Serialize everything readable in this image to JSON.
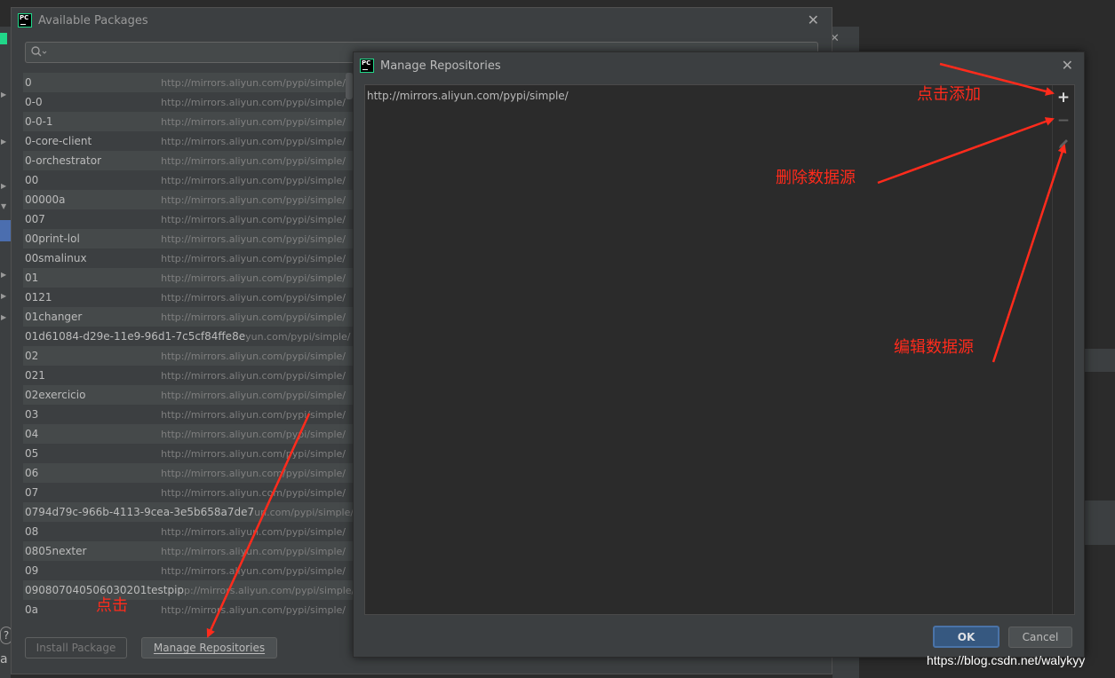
{
  "available_dialog": {
    "title": "Available Packages",
    "install_button": "Install Package",
    "manage_button": "Manage Repositories",
    "packages": [
      {
        "name": "0",
        "repo": "http://mirrors.aliyun.com/pypi/simple/"
      },
      {
        "name": "0-0",
        "repo": "http://mirrors.aliyun.com/pypi/simple/"
      },
      {
        "name": "0-0-1",
        "repo": "http://mirrors.aliyun.com/pypi/simple/"
      },
      {
        "name": "0-core-client",
        "repo": "http://mirrors.aliyun.com/pypi/simple/"
      },
      {
        "name": "0-orchestrator",
        "repo": "http://mirrors.aliyun.com/pypi/simple/"
      },
      {
        "name": "00",
        "repo": "http://mirrors.aliyun.com/pypi/simple/"
      },
      {
        "name": "00000a",
        "repo": "http://mirrors.aliyun.com/pypi/simple/"
      },
      {
        "name": "007",
        "repo": "http://mirrors.aliyun.com/pypi/simple/"
      },
      {
        "name": "00print-lol",
        "repo": "http://mirrors.aliyun.com/pypi/simple/"
      },
      {
        "name": "00smalinux",
        "repo": "http://mirrors.aliyun.com/pypi/simple/"
      },
      {
        "name": "01",
        "repo": "http://mirrors.aliyun.com/pypi/simple/"
      },
      {
        "name": "0121",
        "repo": "http://mirrors.aliyun.com/pypi/simple/"
      },
      {
        "name": "01changer",
        "repo": "http://mirrors.aliyun.com/pypi/simple/"
      },
      {
        "name": "01d61084-d29e-11e9-96d1-7c5cf84ffe8e",
        "repo": "yun.com/pypi/simple/"
      },
      {
        "name": "02",
        "repo": "http://mirrors.aliyun.com/pypi/simple/"
      },
      {
        "name": "021",
        "repo": "http://mirrors.aliyun.com/pypi/simple/"
      },
      {
        "name": "02exercicio",
        "repo": "http://mirrors.aliyun.com/pypi/simple/"
      },
      {
        "name": "03",
        "repo": "http://mirrors.aliyun.com/pypi/simple/"
      },
      {
        "name": "04",
        "repo": "http://mirrors.aliyun.com/pypi/simple/"
      },
      {
        "name": "05",
        "repo": "http://mirrors.aliyun.com/pypi/simple/"
      },
      {
        "name": "06",
        "repo": "http://mirrors.aliyun.com/pypi/simple/"
      },
      {
        "name": "07",
        "repo": "http://mirrors.aliyun.com/pypi/simple/"
      },
      {
        "name": "0794d79c-966b-4113-9cea-3e5b658a7de7",
        "repo": "un.com/pypi/simple/"
      },
      {
        "name": "08",
        "repo": "http://mirrors.aliyun.com/pypi/simple/"
      },
      {
        "name": "0805nexter",
        "repo": "http://mirrors.aliyun.com/pypi/simple/"
      },
      {
        "name": "09",
        "repo": "http://mirrors.aliyun.com/pypi/simple/"
      },
      {
        "name": "090807040506030201testpip",
        "repo": "p://mirrors.aliyun.com/pypi/simple/"
      },
      {
        "name": "0a",
        "repo": "http://mirrors.aliyun.com/pypi/simple/"
      }
    ]
  },
  "manage_dialog": {
    "title": "Manage Repositories",
    "repositories": [
      "http://mirrors.aliyun.com/pypi/simple/"
    ],
    "ok_button": "OK",
    "cancel_button": "Cancel",
    "toolbar_icons": [
      "add-icon",
      "remove-icon",
      "edit-icon"
    ]
  },
  "annotations": {
    "add": "点击添加",
    "delete": "删除数据源",
    "edit": "编辑数据源",
    "click": "点击"
  },
  "watermark": "https://blog.csdn.net/walykyy",
  "background": {
    "partial_text": "?",
    "partial_text2": "a"
  },
  "colors": {
    "annotation": "#ff2b1c",
    "dialog_bg": "#3c3f41",
    "ok_button": "#365880"
  }
}
